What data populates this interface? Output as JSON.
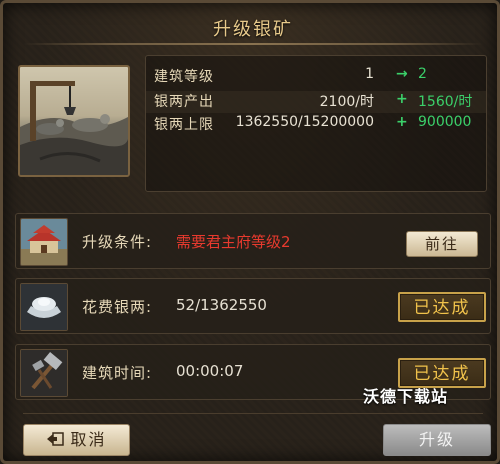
{
  "dialog": {
    "title": "升级银矿"
  },
  "stats": [
    {
      "label": "建筑等级",
      "current": "1",
      "op": "→",
      "next": "2"
    },
    {
      "label": "银两产出",
      "current": "2100/时",
      "op": "+",
      "next": "1560/时"
    },
    {
      "label": "银两上限",
      "current": "1362550/15200000",
      "op": "+",
      "next": "900000"
    }
  ],
  "requirements": [
    {
      "label": "升级条件:",
      "value": "需要君主府等级2",
      "action": "前往"
    },
    {
      "label": "花费银两:",
      "value": "52/1362550",
      "status": "已达成"
    },
    {
      "label": "建筑时间:",
      "value": "00:00:07",
      "status": "已达成"
    }
  ],
  "footer": {
    "cancel_label": "取消",
    "upgrade_label": "升级"
  },
  "watermark": "沃德下载站",
  "colors": {
    "accent": "#e7c98a",
    "positive": "#3bd06a",
    "warning": "#e83a2e",
    "badge": "#f0c24b"
  }
}
